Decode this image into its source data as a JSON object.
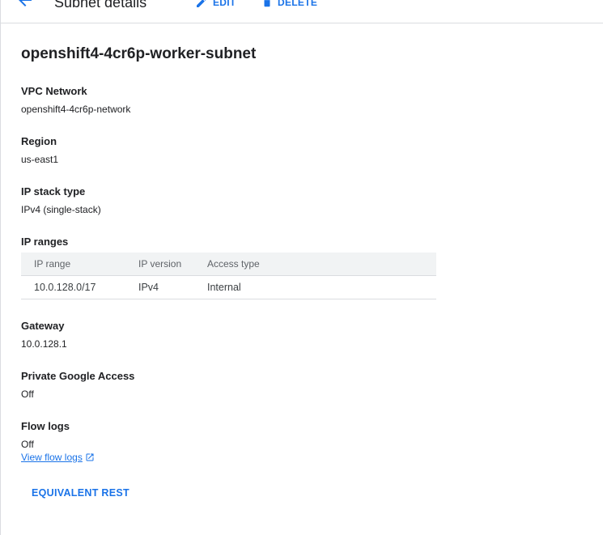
{
  "header": {
    "title": "Subnet details",
    "edit_label": "EDIT",
    "delete_label": "DELETE"
  },
  "subnet": {
    "name": "openshift4-4cr6p-worker-subnet"
  },
  "fields": {
    "vpc_network": {
      "label": "VPC Network",
      "value": "openshift4-4cr6p-network"
    },
    "region": {
      "label": "Region",
      "value": "us-east1"
    },
    "ip_stack_type": {
      "label": "IP stack type",
      "value": "IPv4 (single-stack)"
    },
    "ip_ranges": {
      "label": "IP ranges"
    },
    "gateway": {
      "label": "Gateway",
      "value": "10.0.128.1"
    },
    "private_google_access": {
      "label": "Private Google Access",
      "value": "Off"
    },
    "flow_logs": {
      "label": "Flow logs",
      "value": "Off",
      "link_label": "View flow logs"
    }
  },
  "ip_table": {
    "columns": [
      "IP range",
      "IP version",
      "Access type"
    ],
    "rows": [
      [
        "10.0.128.0/17",
        "IPv4",
        "Internal"
      ]
    ]
  },
  "footer": {
    "equivalent_rest_label": "EQUIVALENT REST"
  },
  "colors": {
    "accent": "#1a73e8",
    "text": "#202124",
    "header_bg": "#f1f3f4",
    "divider": "#dadce0"
  },
  "icons": {
    "back": "arrow-back-icon",
    "edit": "pencil-icon",
    "delete": "trash-icon",
    "external": "external-link-icon"
  }
}
